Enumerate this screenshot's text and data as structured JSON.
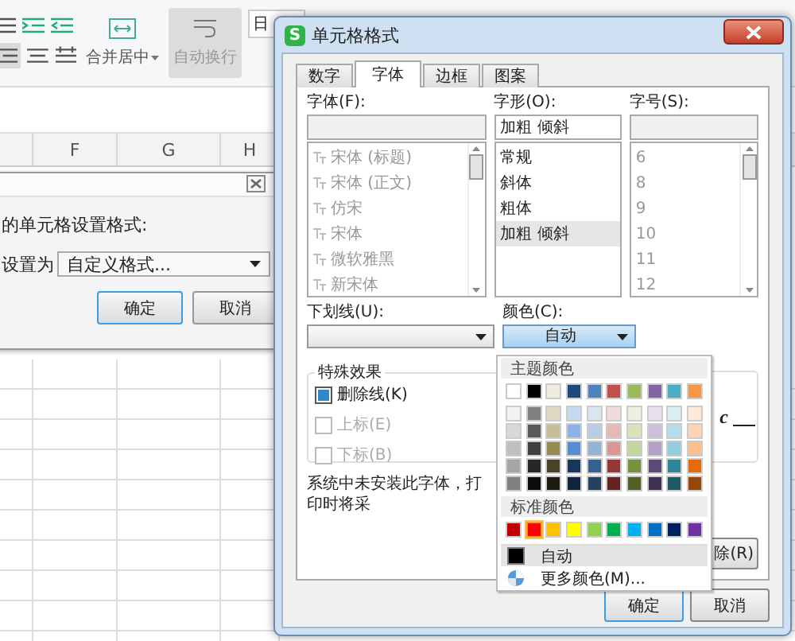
{
  "spreadsheet": {
    "ribbon": {
      "merge_button": "合并居中",
      "wrap_button": {
        "label": "自动换行",
        "selected": true
      },
      "date_field": "日"
    },
    "column_headers": [
      "F",
      "G",
      "H"
    ]
  },
  "behind_dialog": {
    "prompt": "的单元格设置格式:",
    "apply_label": "设置为",
    "format_value": "自定义格式...",
    "buttons": [
      "确定",
      "取消"
    ]
  },
  "dialog": {
    "logo": "S",
    "title": "单元格格式",
    "tabs": [
      {
        "label": "数字",
        "selected": false
      },
      {
        "label": "字体",
        "selected": true
      },
      {
        "label": "边框",
        "selected": false
      },
      {
        "label": "图案",
        "selected": false
      }
    ],
    "font": {
      "label": "字体(F):",
      "items": [
        {
          "label": "宋体 (标题)",
          "disabled": true
        },
        {
          "label": "宋体 (正文)",
          "disabled": true
        },
        {
          "label": "仿宋",
          "disabled": true
        },
        {
          "label": "宋体",
          "disabled": true
        },
        {
          "label": "微软雅黑",
          "disabled": true
        },
        {
          "label": "新宋体",
          "disabled": true
        }
      ]
    },
    "style": {
      "label": "字形(O):",
      "value": "加粗 倾斜",
      "items": [
        {
          "label": "常规",
          "selected": false
        },
        {
          "label": "斜体",
          "selected": false
        },
        {
          "label": "粗体",
          "selected": false
        },
        {
          "label": "加粗 倾斜",
          "selected": true
        }
      ]
    },
    "size": {
      "label": "字号(S):",
      "items": [
        {
          "label": "6",
          "disabled": true
        },
        {
          "label": "8",
          "disabled": true
        },
        {
          "label": "9",
          "disabled": true
        },
        {
          "label": "10",
          "disabled": true
        },
        {
          "label": "11",
          "disabled": true
        },
        {
          "label": "12",
          "disabled": true
        }
      ]
    },
    "underline": {
      "label": "下划线(U):"
    },
    "color": {
      "label": "颜色(C):",
      "value": "自动"
    },
    "effects": {
      "title": "特殊效果",
      "items": [
        {
          "label": "删除线(K)",
          "checked": true,
          "disabled": false
        },
        {
          "label": "上标(E)",
          "checked": false,
          "disabled": true
        },
        {
          "label": "下标(B)",
          "checked": false,
          "disabled": true
        }
      ]
    },
    "preview_text": "c",
    "notice": "系统中未安装此字体，打印时将采",
    "delete_button": "除(R)",
    "buttons": [
      "确定",
      "取消"
    ]
  },
  "color_menu": {
    "theme_title": "主题颜色",
    "theme_colors": [
      {
        "color": "#ffffff"
      },
      {
        "color": "#000000"
      },
      {
        "color": "#eeece1"
      },
      {
        "color": "#1f497d"
      },
      {
        "color": "#4f81bd"
      },
      {
        "color": "#c0504d"
      },
      {
        "color": "#9bbb59"
      },
      {
        "color": "#8064a2"
      },
      {
        "color": "#4bacc6"
      },
      {
        "color": "#f79646"
      }
    ],
    "shades": [
      {
        "color": "#f2f2f2"
      },
      {
        "color": "#7f7f7f"
      },
      {
        "color": "#ddd9c3"
      },
      {
        "color": "#c6d9f0"
      },
      {
        "color": "#dbe5f1"
      },
      {
        "color": "#f2dcdb"
      },
      {
        "color": "#ebf1dd"
      },
      {
        "color": "#e5e0ec"
      },
      {
        "color": "#dbeef3"
      },
      {
        "color": "#fdeada"
      },
      {
        "color": "#d8d8d8"
      },
      {
        "color": "#595959"
      },
      {
        "color": "#c4bd97"
      },
      {
        "color": "#8db3e2"
      },
      {
        "color": "#b8cce4"
      },
      {
        "color": "#e5b9b7"
      },
      {
        "color": "#d7e3bc"
      },
      {
        "color": "#ccc1d9"
      },
      {
        "color": "#b7dde8"
      },
      {
        "color": "#fbd5b5"
      },
      {
        "color": "#bfbfbf"
      },
      {
        "color": "#3f3f3f"
      },
      {
        "color": "#938953"
      },
      {
        "color": "#548dd4"
      },
      {
        "color": "#95b3d7"
      },
      {
        "color": "#d99694"
      },
      {
        "color": "#c3d69b"
      },
      {
        "color": "#b2a2c7"
      },
      {
        "color": "#92cddc"
      },
      {
        "color": "#fac08f"
      },
      {
        "color": "#a5a5a5"
      },
      {
        "color": "#262626"
      },
      {
        "color": "#494429"
      },
      {
        "color": "#17365d"
      },
      {
        "color": "#366092"
      },
      {
        "color": "#953734"
      },
      {
        "color": "#76923c"
      },
      {
        "color": "#5f497a"
      },
      {
        "color": "#31859b"
      },
      {
        "color": "#e36c09"
      },
      {
        "color": "#7f7f7f"
      },
      {
        "color": "#0c0c0c"
      },
      {
        "color": "#1d1b10"
      },
      {
        "color": "#0f243e"
      },
      {
        "color": "#244061"
      },
      {
        "color": "#632423"
      },
      {
        "color": "#4f6128"
      },
      {
        "color": "#3f3151"
      },
      {
        "color": "#205867"
      },
      {
        "color": "#974806"
      }
    ],
    "standard_title": "标准颜色",
    "standard_colors": [
      {
        "color": "#c00000",
        "selected": false
      },
      {
        "color": "#ff0000",
        "selected": true
      },
      {
        "color": "#ffc000",
        "selected": false
      },
      {
        "color": "#ffff00",
        "selected": false
      },
      {
        "color": "#92d050",
        "selected": false
      },
      {
        "color": "#00b050",
        "selected": false
      },
      {
        "color": "#00b0f0",
        "selected": false
      },
      {
        "color": "#0070c0",
        "selected": false
      },
      {
        "color": "#002060",
        "selected": false
      },
      {
        "color": "#7030a0",
        "selected": false
      }
    ],
    "auto": {
      "label": "自动",
      "color": "#000000",
      "selected": true
    },
    "more_label": "更多颜色(M)..."
  }
}
